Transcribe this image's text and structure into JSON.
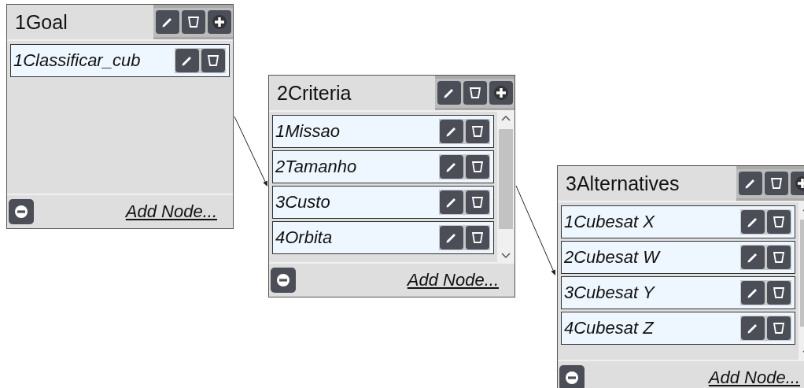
{
  "nodes": [
    {
      "title": "1Goal",
      "scrollable": false,
      "add_label": "Add Node...",
      "items": [
        {
          "label": "1Classificar_cub"
        }
      ]
    },
    {
      "title": "2Criteria",
      "scrollable": true,
      "add_label": "Add Node...",
      "items": [
        {
          "label": "1Missao"
        },
        {
          "label": "2Tamanho"
        },
        {
          "label": "3Custo"
        },
        {
          "label": "4Orbita"
        }
      ]
    },
    {
      "title": "3Alternatives",
      "scrollable": true,
      "add_label": "Add Node...",
      "items": [
        {
          "label": "1Cubesat X"
        },
        {
          "label": "2Cubesat W"
        },
        {
          "label": "3Cubesat Y"
        },
        {
          "label": "4Cubesat Z"
        }
      ]
    }
  ]
}
